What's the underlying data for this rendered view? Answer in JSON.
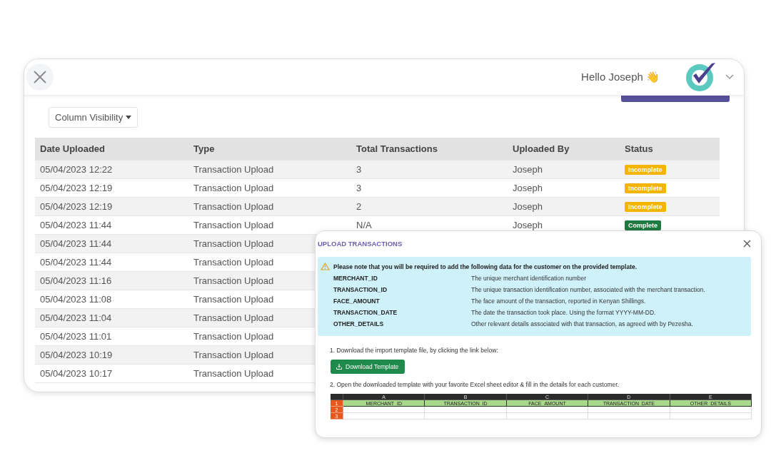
{
  "header": {
    "greeting": "Hello Joseph 👋"
  },
  "toolbar": {
    "column_visibility": "Column Visibility"
  },
  "table": {
    "columns": [
      "Date Uploaded",
      "Type",
      "Total Transactions",
      "Uploaded By",
      "Status"
    ],
    "rows": [
      {
        "date": "05/04/2023 12:22",
        "type": "Transaction Upload",
        "total": "3",
        "by": "Joseph",
        "status": {
          "label": "Incomplete",
          "kind": "incomplete"
        }
      },
      {
        "date": "05/04/2023 12:19",
        "type": "Transaction Upload",
        "total": "3",
        "by": "Joseph",
        "status": {
          "label": "Incomplete",
          "kind": "incomplete"
        }
      },
      {
        "date": "05/04/2023 12:19",
        "type": "Transaction Upload",
        "total": "2",
        "by": "Joseph",
        "status": {
          "label": "Incomplete",
          "kind": "incomplete"
        }
      },
      {
        "date": "05/04/2023 11:44",
        "type": "Transaction Upload",
        "total": "N/A",
        "by": "Joseph",
        "status": {
          "label": "Complete",
          "kind": "complete"
        }
      },
      {
        "date": "05/04/2023 11:44",
        "type": "Transaction Upload"
      },
      {
        "date": "05/04/2023 11:44",
        "type": "Transaction Upload"
      },
      {
        "date": "05/04/2023 11:16",
        "type": "Transaction Upload"
      },
      {
        "date": "05/04/2023 11:08",
        "type": "Transaction Upload"
      },
      {
        "date": "05/04/2023 11:04",
        "type": "Transaction Upload"
      },
      {
        "date": "05/04/2023 11:01",
        "type": "Transaction Upload"
      },
      {
        "date": "05/04/2023 10:19",
        "type": "Transaction Upload"
      },
      {
        "date": "05/04/2023 10:17",
        "type": "Transaction Upload"
      }
    ]
  },
  "modal": {
    "title": "UPLOAD TRANSACTIONS",
    "notice": "Please note that you will be required to add the following data for the customer on the provided template.",
    "fields": [
      {
        "name": "MERCHANT_ID",
        "description": "The unique merchant identification number"
      },
      {
        "name": "TRANSACTION_ID",
        "description": "The unique transaction identification number, associated with the merchant transaction."
      },
      {
        "name": "FACE_AMOUNT",
        "description": "The face amount of the transaction, reported in Kenyan Shillings."
      },
      {
        "name": "TRANSACTION_DATE",
        "description": "The date the transaction took place. Using the format YYYY-MM-DD."
      },
      {
        "name": "OTHER_DETAILS",
        "description": "Other relevant details associated with that transaction, as agreed with by Pezesha."
      }
    ],
    "step_1": "1. Download the import template file, by clicking the link below:",
    "download_button": "Download Template",
    "step_2": "2. Open the downloaded template with your favorite Excel sheet editor & fill in the details for each customer.",
    "sheet": {
      "column_letters": [
        "A",
        "B",
        "C",
        "D",
        "E"
      ],
      "row_numbers": [
        "1",
        "2",
        "3"
      ],
      "header_cells": [
        "MERCHANT_ID",
        "TRANSACTION_ID",
        "FACE_AMOUNT",
        "TRANSACTION_DATE",
        "OTHER_DETAILS"
      ]
    }
  }
}
